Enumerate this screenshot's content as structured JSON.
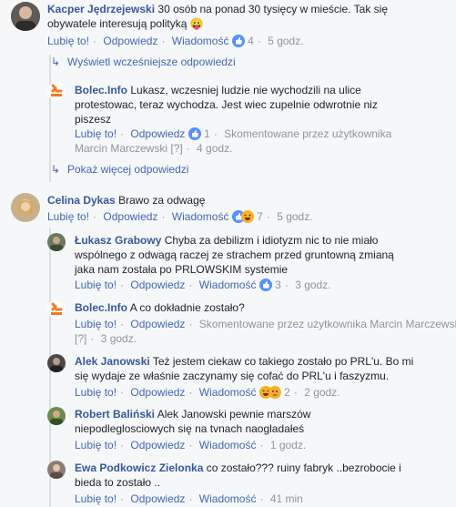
{
  "comments": [
    {
      "id": "c1",
      "author": "Kacper Jędrzejewski",
      "text": "30 osób na ponad 30 tysięcy w mieście. Tak się obywatele interesują polityką",
      "like": "Lubię to!",
      "reply": "Odpowiedz",
      "message": "Wiadomość",
      "reactions": "4",
      "time": "5 godz."
    },
    {
      "id": "r1",
      "author": "Bolec.Info",
      "text": "Lukasz, wczesniej ludzie nie wychodzili na ulice protestowac, teraz wychodza. Jest wiec zupelnie odwrotnie niz piszesz",
      "like": "Lubię to!",
      "reply": "Odpowiedz",
      "reactions": "1",
      "edited": "Skomentowane przez użytkownika",
      "edited_by": "Marcin Marczewski",
      "edited_tag": "[?]",
      "time": "4 godz."
    },
    {
      "id": "c2",
      "author": "Celina Dykas",
      "text": "Brawo za odwagę",
      "like": "Lubię to!",
      "reply": "Odpowiedz",
      "message": "Wiadomość",
      "reactions": "7",
      "time": "5 godz."
    },
    {
      "id": "r2",
      "author": "Łukasz Grabowy",
      "text": "Chyba za debilizm i idiotyzm nic to nie miało wspólnego z odwagą raczej ze strachem przed gruntowną zmianą jaka nam została po PRLOWSKIM systemie",
      "like": "Lubię to!",
      "reply": "Odpowiedz",
      "message": "Wiadomość",
      "reactions": "3",
      "time": "3 godz."
    },
    {
      "id": "r3",
      "author": "Bolec.Info",
      "text": "A co dokładnie zostało?",
      "like": "Lubię to!",
      "reply": "Odpowiedz",
      "edited": "Skomentowane przez użytkownika",
      "edited_by": "Marcin Marczewski",
      "edited_tag": "[?]",
      "time": "3 godz."
    },
    {
      "id": "r4",
      "author": "Alek Janowski",
      "text": "Też jestem ciekaw co takiego zostało po PRL'u. Bo mi się wydaje ze właśnie zaczynamy się cofać do PRL'u i faszyzmu.",
      "like": "Lubię to!",
      "reply": "Odpowiedz",
      "message": "Wiadomość",
      "reactions": "2",
      "time": "2 godz."
    },
    {
      "id": "r5",
      "author": "Robert Baliński",
      "text": "Alek Janowski pewnie marszów niepodleglosciowych się na tvnach naogladałeś",
      "like": "Lubię to!",
      "reply": "Odpowiedz",
      "message": "Wiadomość",
      "time": "1 godz."
    },
    {
      "id": "r6",
      "author": "Ewa Podkowicz Zielonka",
      "text": "co zostało??? ruiny fabryk ..bezrobocie i bieda to zostało ..",
      "like": "Lubię to!",
      "reply": "Odpowiedz",
      "message": "Wiadomość",
      "time": "41 min"
    }
  ],
  "expanders": {
    "earlier": "Wyświetl wcześniejsze odpowiedzi",
    "more": "Pokaż więcej odpowiedzi"
  },
  "emoji": {
    "c1": "😛"
  },
  "colors": {
    "link": "#4267b2",
    "author": "#365899",
    "meta": "#90949c",
    "background": "#f6f7f9"
  }
}
